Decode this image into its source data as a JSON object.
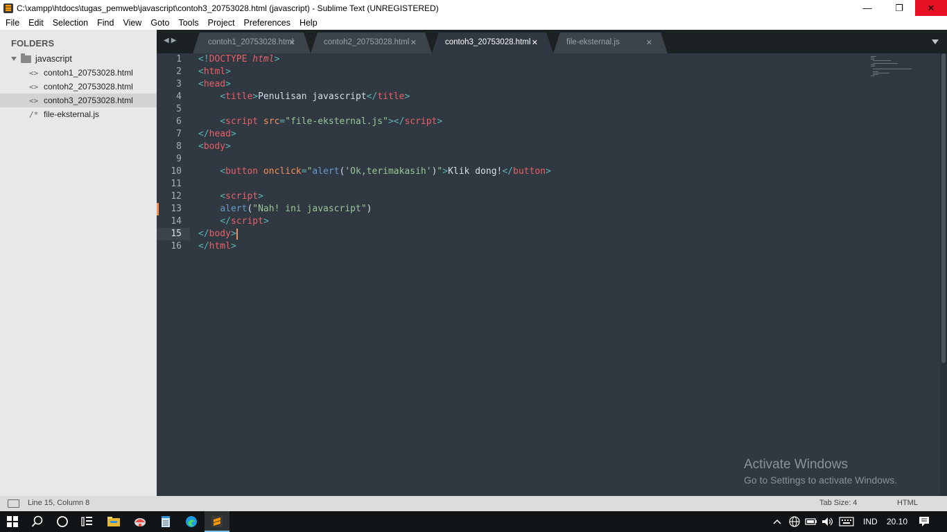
{
  "window": {
    "title": "C:\\xampp\\htdocs\\tugas_pemweb\\javascript\\contoh3_20753028.html (javascript) - Sublime Text (UNREGISTERED)",
    "min_glyph": "—",
    "max_glyph": "❐",
    "close_glyph": "✕"
  },
  "menu": [
    "File",
    "Edit",
    "Selection",
    "Find",
    "View",
    "Goto",
    "Tools",
    "Project",
    "Preferences",
    "Help"
  ],
  "sidebar": {
    "heading": "FOLDERS",
    "folder": "javascript",
    "files": [
      {
        "icon": "<>",
        "name": "contoh1_20753028.html"
      },
      {
        "icon": "<>",
        "name": "contoh2_20753028.html"
      },
      {
        "icon": "<>",
        "name": "contoh3_20753028.html"
      },
      {
        "icon": "/*",
        "name": "file-eksternal.js"
      }
    ]
  },
  "tabs": [
    {
      "label": "contoh1_20753028.html",
      "close": "✕"
    },
    {
      "label": "contoh2_20753028.html",
      "close": "✕"
    },
    {
      "label": "contoh3_20753028.html",
      "close": "✕"
    },
    {
      "label": "file-eksternal.js",
      "close": "✕"
    }
  ],
  "editor": {
    "line_numbers": [
      "1",
      "2",
      "3",
      "4",
      "5",
      "6",
      "7",
      "8",
      "9",
      "10",
      "11",
      "12",
      "13",
      "14",
      "15",
      "16"
    ],
    "current_line": 15,
    "modified_line": 13,
    "code": {
      "l1": {
        "a": "<!",
        "b": "DOCTYPE ",
        "c": "html",
        "d": ">"
      },
      "l2": {
        "a": "<",
        "b": "html",
        "c": ">"
      },
      "l3": {
        "a": "<",
        "b": "head",
        "c": ">"
      },
      "l4": {
        "indent": "    ",
        "a": "<",
        "b": "title",
        "c": ">",
        "d": "Penulisan javascript",
        "e": "</",
        "f": "title",
        "g": ">"
      },
      "l6": {
        "indent": "    ",
        "a": "<",
        "b": "script",
        "c": " src",
        "d": "=",
        "e": "\"",
        "f": "file-eksternal.js",
        "g": "\"",
        "h": ">",
        "i": "</",
        "j": "script",
        "k": ">"
      },
      "l7": {
        "a": "</",
        "b": "head",
        "c": ">"
      },
      "l8": {
        "a": "<",
        "b": "body",
        "c": ">"
      },
      "l10": {
        "indent": "    ",
        "a": "<",
        "b": "button",
        "c": " onclick",
        "d": "=",
        "e": "\"",
        "f": "alert",
        "g": "(",
        "h": "'Ok,terimakasih'",
        "i": ")",
        "j": "\"",
        "k": ">",
        "l": "Klik dong!",
        "m": "</",
        "n": "button",
        "o": ">"
      },
      "l12": {
        "indent": "    ",
        "a": "<",
        "b": "script",
        "c": ">"
      },
      "l13": {
        "indent": "    ",
        "a": "alert",
        "b": "(",
        "c": "\"Nah! ini javascript\"",
        "d": ")"
      },
      "l14": {
        "indent": "    ",
        "a": "</",
        "b": "script",
        "c": ">"
      },
      "l15": {
        "a": "</",
        "b": "body",
        "c": ">"
      },
      "l16": {
        "a": "</",
        "b": "html",
        "c": ">"
      }
    }
  },
  "watermark": {
    "line1": "Activate Windows",
    "line2": "Go to Settings to activate Windows."
  },
  "status": {
    "position": "Line 15, Column 8",
    "tab_size": "Tab Size: 4",
    "syntax": "HTML"
  },
  "taskbar": {
    "language": "IND",
    "time": "20.10"
  },
  "colors": {
    "editor_bg": "#303841",
    "sidebar_bg": "#e8e8e8",
    "tabbar_bg": "#1c2124",
    "punctuation": "#5fb4b4",
    "tag": "#ec5f67",
    "attribute": "#f99157",
    "string": "#99c794",
    "function": "#6699cc",
    "close_button": "#e81123"
  }
}
